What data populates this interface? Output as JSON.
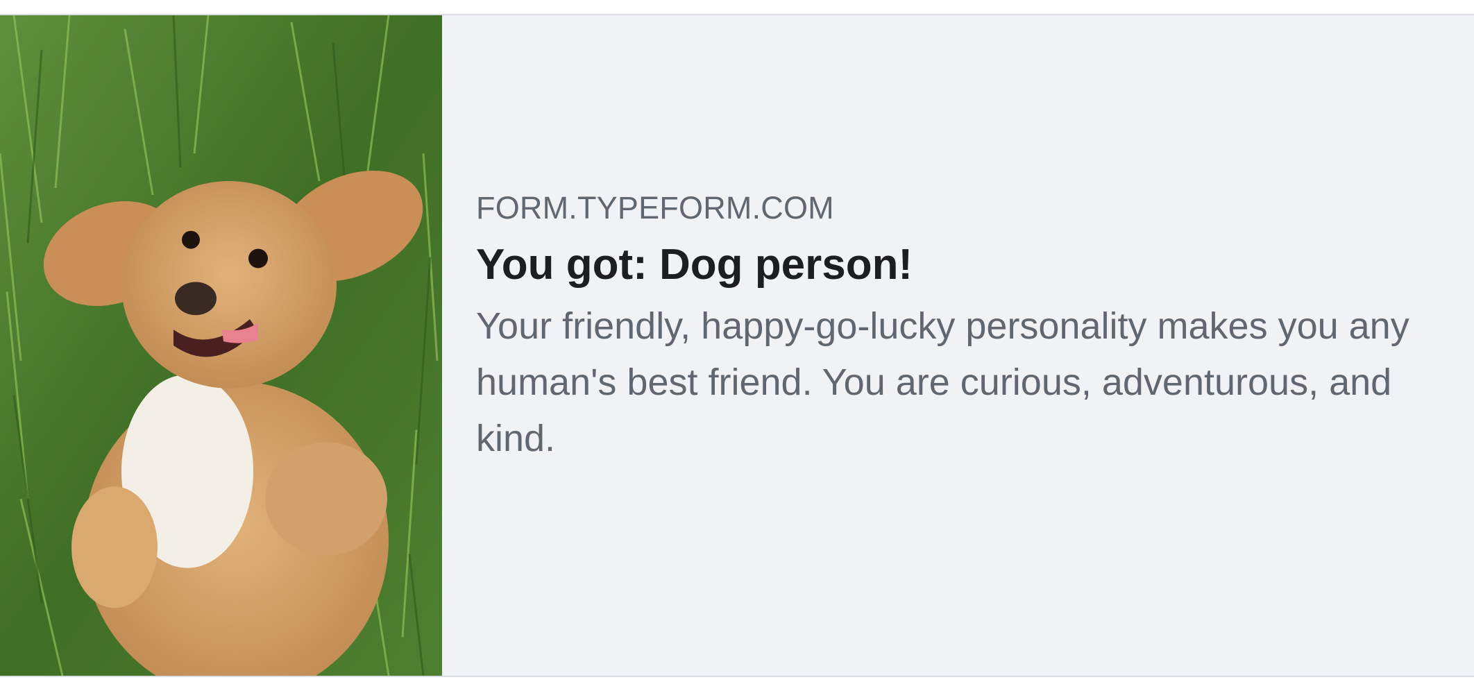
{
  "link_preview": {
    "image_alt": "dog-lying-in-grass-photo",
    "domain": "FORM.TYPEFORM.COM",
    "title": "You got: Dog person!",
    "description": "Your friendly, happy-go-lucky personality makes you any human's best friend. You are curious, adventurous, and kind."
  },
  "colors": {
    "card_background": "#f0f2f5",
    "domain_text": "#606770",
    "title_text": "#1c1e21",
    "description_text": "#606770"
  }
}
